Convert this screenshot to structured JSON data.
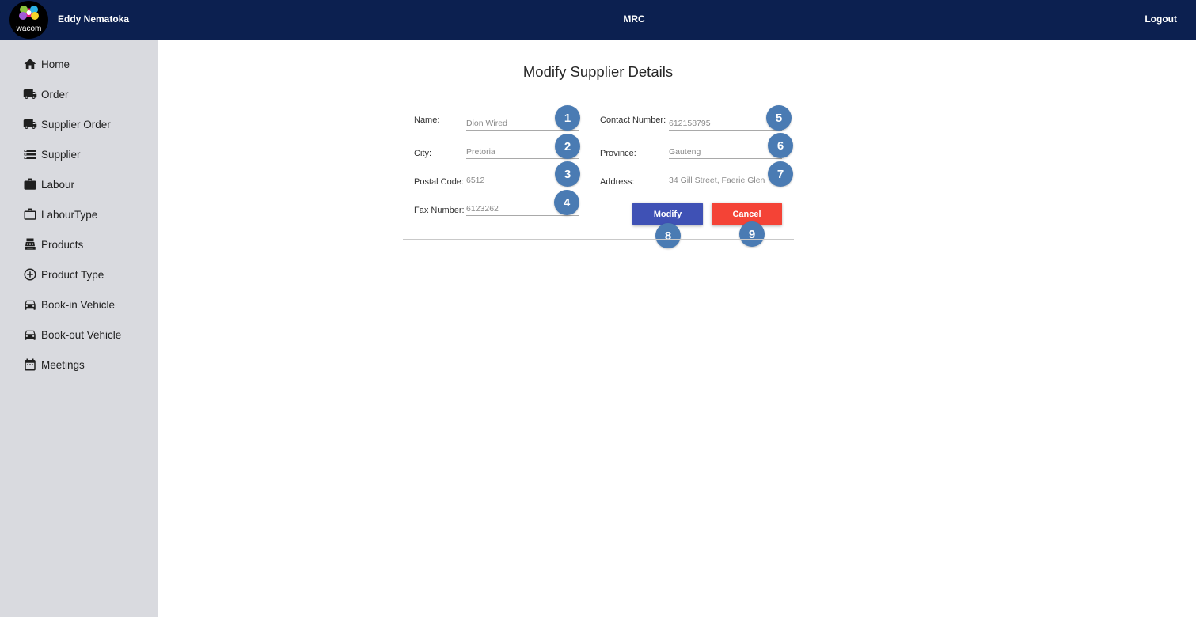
{
  "header": {
    "logo_text": "wacom",
    "user_name": "Eddy Nematoka",
    "app_title": "MRC",
    "logout_label": "Logout"
  },
  "sidebar": {
    "items": [
      {
        "label": "Home",
        "icon": "home-icon"
      },
      {
        "label": "Order",
        "icon": "truck-icon"
      },
      {
        "label": "Supplier Order",
        "icon": "truck-icon"
      },
      {
        "label": "Supplier",
        "icon": "storage-icon"
      },
      {
        "label": "Labour",
        "icon": "briefcase-icon"
      },
      {
        "label": "LabourType",
        "icon": "briefcase-outline-icon"
      },
      {
        "label": "Products",
        "icon": "cash-register-icon"
      },
      {
        "label": "Product Type",
        "icon": "add-circle-icon"
      },
      {
        "label": "Book-in Vehicle",
        "icon": "car-icon"
      },
      {
        "label": "Book-out Vehicle",
        "icon": "car-icon"
      },
      {
        "label": "Meetings",
        "icon": "calendar-icon"
      }
    ]
  },
  "main": {
    "title": "Modify Supplier Details",
    "fields": {
      "name": {
        "label": "Name:",
        "value": "Dion Wired",
        "badge": "1"
      },
      "city": {
        "label": "City:",
        "value": "Pretoria",
        "badge": "2"
      },
      "postal_code": {
        "label": "Postal Code:",
        "value": "6512",
        "badge": "3"
      },
      "fax_number": {
        "label": "Fax Number:",
        "value": "6123262",
        "badge": "4"
      },
      "contact_number": {
        "label": "Contact Number:",
        "value": "612158795",
        "badge": "5"
      },
      "province": {
        "label": "Province:",
        "value": "Gauteng",
        "badge": "6"
      },
      "address": {
        "label": "Address:",
        "value": "34 Gill Street, Faerie Glen",
        "badge": "7"
      }
    },
    "buttons": {
      "modify": {
        "label": "Modify",
        "badge": "8"
      },
      "cancel": {
        "label": "Cancel",
        "badge": "9"
      }
    }
  },
  "colors": {
    "header_bg": "#0c2050",
    "sidebar_bg": "#d9dadf",
    "modify_button": "#3f51b5",
    "cancel_button": "#f44336",
    "badge": "#4a7bb3"
  }
}
